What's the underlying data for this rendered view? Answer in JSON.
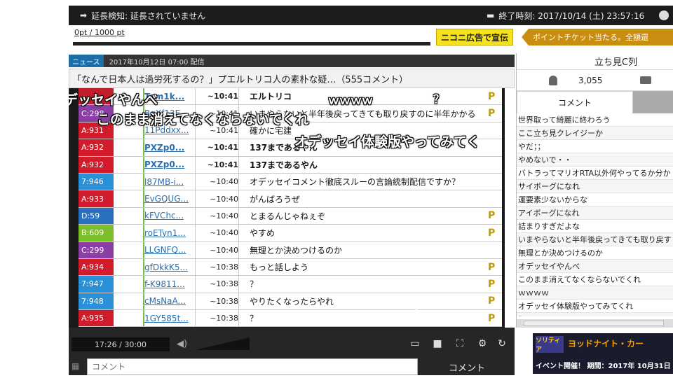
{
  "topbar": {
    "extension_notice": "延長検知: 延長されていません",
    "end_time": "終了時刻: 2017/10/14 (土) 23:57:16"
  },
  "points": {
    "text": "0pt / 1000 pt",
    "ad_button": "ニコニ広告で宣伝",
    "ticket_banner": "ポイントチケット当たる。全額還"
  },
  "news": {
    "tag": "ニュース",
    "date": "2017年10月12日 07:00 配信",
    "title": "「なんで日本人は過労死するの？」プエルトリコ人の素朴な疑…（555コメント）"
  },
  "video_table": {
    "rows": [
      {
        "room": "",
        "room_color": "#c21e2c",
        "uid": "Tom1k...",
        "time": "~10:41",
        "msg": "エルトリコ",
        "p": true,
        "bold": true
      },
      {
        "room": "C:298",
        "room_color": "#8b3fa6",
        "uid": "BqXf13E...",
        "time": "~10:41",
        "msg": "いまやらないと半年後戻ってきても取り戻すのに半年かかる",
        "p": true,
        "bold": false
      },
      {
        "room": "A:931",
        "room_color": "#d21c2c",
        "uid": "11Pddxx...",
        "time": "~10:41",
        "msg": "確かに宅建",
        "p": false,
        "bold": false
      },
      {
        "room": "A:932",
        "room_color": "#d21c2c",
        "uid": "PXZp0...",
        "time": "~10:41",
        "msg": "137まであるやん",
        "p": false,
        "bold": true
      },
      {
        "room": "A:932",
        "room_color": "#d21c2c",
        "uid": "PXZp0...",
        "time": "~10:41",
        "msg": "137まであるやん",
        "p": false,
        "bold": true
      },
      {
        "room": "7:946",
        "room_color": "#2a90d8",
        "uid": "l87MB-i...",
        "time": "~10:40",
        "msg": "オデッセイコメント徹底スルーの言論統制配信ですか？",
        "p": false,
        "bold": false
      },
      {
        "room": "A:933",
        "room_color": "#d21c2c",
        "uid": "EvGQUG...",
        "time": "~10:40",
        "msg": "がんばろうぜ",
        "p": false,
        "bold": false
      },
      {
        "room": "D:59",
        "room_color": "#2a70c0",
        "uid": "kFVChc...",
        "time": "~10:40",
        "msg": "とまるんじゃねぇぞ",
        "p": true,
        "bold": false
      },
      {
        "room": "B:609",
        "room_color": "#7cbf2a",
        "uid": "roETyn1...",
        "time": "~10:40",
        "msg": "やすめ",
        "p": true,
        "bold": false
      },
      {
        "room": "C:299",
        "room_color": "#8b3fa6",
        "uid": "LLGNFQ...",
        "time": "~10:40",
        "msg": "無理とか決めつけるのか",
        "p": false,
        "bold": false
      },
      {
        "room": "A:934",
        "room_color": "#d21c2c",
        "uid": "gfDkkK5...",
        "time": "~10:38",
        "msg": "もっと話しよう",
        "p": true,
        "bold": false
      },
      {
        "room": "7:947",
        "room_color": "#2a90d8",
        "uid": "f-K9811...",
        "time": "~10:38",
        "msg": "？",
        "p": true,
        "bold": false
      },
      {
        "room": "7:948",
        "room_color": "#2a90d8",
        "uid": "cMsNaA...",
        "time": "~10:38",
        "msg": "やりたくなったらやれ",
        "p": true,
        "bold": false
      },
      {
        "room": "A:935",
        "room_color": "#d21c2c",
        "uid": "1GY585t...",
        "time": "~10:38",
        "msg": "？",
        "p": true,
        "bold": false
      }
    ]
  },
  "flow_comments": [
    "デッセイやんべ",
    "このまま消えてなくならないでくれ",
    "ｗｗｗｗ",
    "？",
    "オデッセイ体験版やってみてく"
  ],
  "controls": {
    "time": "17:26 / 30:00",
    "volume_level": 0.85,
    "comment_placeholder": "コメント",
    "comment_button": "コメント"
  },
  "right_panel": {
    "seat": "立ち見C列",
    "viewers": "3,055",
    "tab_comments": "コメント",
    "comments": [
      "世界取って綺麗に終わろう",
      "ここ立ち見クレイジーか",
      "やだ；；",
      "やめないで・・",
      "バトラってマリオRTA以外何やってるか分か",
      "サイボーグになれ",
      "運要素少ないからな",
      "アイボーグになれ",
      "詰まりすぎだよな",
      "いまやらないと半年後戻ってきても取り戻す",
      "無理とか決めつけるのか",
      "オデッセイやんべ",
      "このまま消えてなくならないでくれ",
      "ｗｗｗｗ",
      "オデッセイ体験版やってみてくれ",
      "？"
    ]
  },
  "banner": {
    "logo": "ソリティア",
    "headline": "ヨッドナイト・カー",
    "subtitle": "イベント開催！ 期間：2017年 10月31日"
  }
}
